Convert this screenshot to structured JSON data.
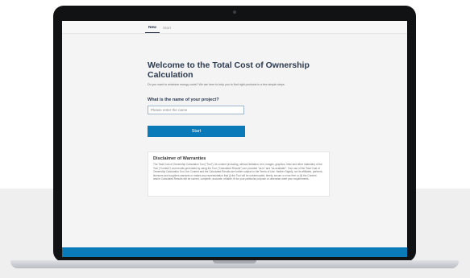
{
  "tabs": [
    {
      "label": "New",
      "active": true
    },
    {
      "label": "Start",
      "active": false
    }
  ],
  "main": {
    "title": "Welcome to the Total Cost of Ownership Calculation",
    "intro": "Do you want to minimize energy costs? We are here to help you to find right products in a few simple steps.",
    "question": "What is the name of your project?",
    "input_placeholder": "Please enter the name",
    "input_value": "",
    "start_label": "Start"
  },
  "disclaimer": {
    "heading": "Disclaimer of Warranties",
    "text": "The Total Cost of Ownership Calculation Tool (\"Tool\"), its content (including, without limitation, text, images, graphics, links and other materials) of the Tool (\"Content\") and results generated by using the Tool (\"Calculated Results\") are provided \"as is\" and \"as available\". Your use of the Total Cost of Ownership Calculation Tool, the Content and the Calculated Results are further subject to the Terms of Use. Neither Signify, nor its affiliates, partners, licensors and suppliers warrants or makes any representation that (i) the Tool will be uninterrupted, timely, secure or error free or (ii) the Content and/or Calculated Results will be correct, complete, accurate, reliable, fit for your particular purpose or otherwise meet your requirements."
  },
  "colors": {
    "accent": "#0a7ab8",
    "title": "#2b3a4f",
    "bezel": "#111214"
  }
}
